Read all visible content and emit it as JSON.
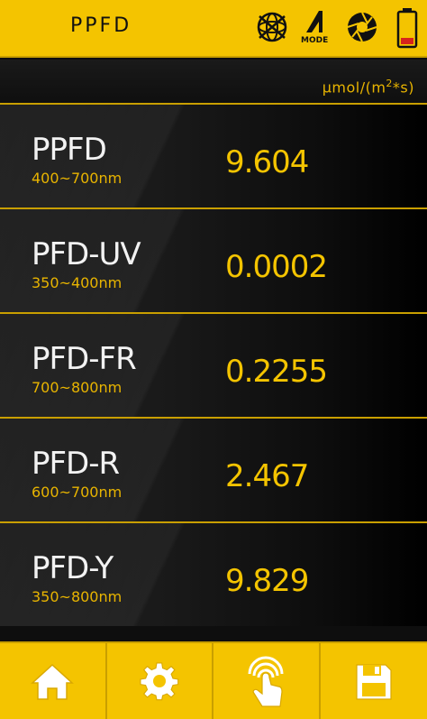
{
  "header": {
    "title": "PPFD",
    "mode_label": "MODE"
  },
  "unit": {
    "base": "μmol/(m",
    "exp": "2",
    "tail": "*s)"
  },
  "rows": [
    {
      "name": "PPFD",
      "range": "400~700nm",
      "value": "9.604"
    },
    {
      "name": "PFD-UV",
      "range": "350~400nm",
      "value": "0.0002"
    },
    {
      "name": "PFD-FR",
      "range": "700~800nm",
      "value": "0.2255"
    },
    {
      "name": "PFD-R",
      "range": "600~700nm",
      "value": "2.467"
    },
    {
      "name": "PFD-Y",
      "range": "350~800nm",
      "value": "9.829"
    }
  ],
  "footer": {
    "buttons": [
      "home-icon",
      "gear-icon",
      "touch-hand-icon",
      "save-icon"
    ]
  },
  "colors": {
    "accent": "#f4c400",
    "background": "#0e0e0e",
    "text": "#f2f2f2"
  }
}
